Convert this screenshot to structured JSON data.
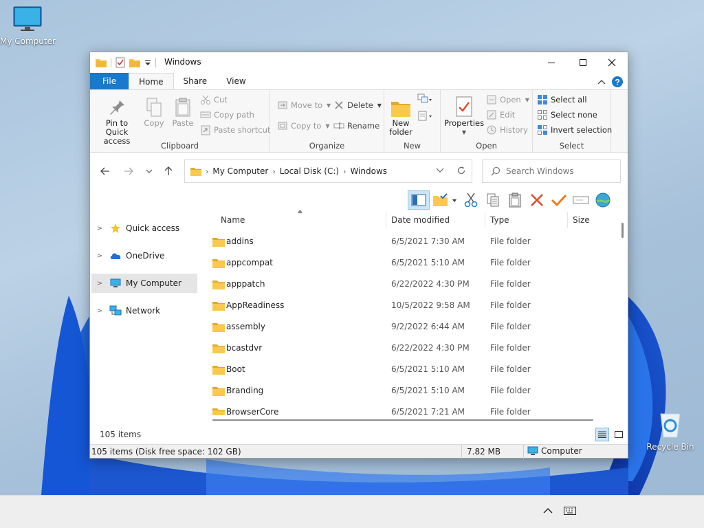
{
  "desktop": {
    "my_computer": "My Computer",
    "recycle_bin": "Recycle Bin"
  },
  "window": {
    "title": "Windows",
    "tabs": [
      "File",
      "Home",
      "Share",
      "View"
    ],
    "active_tab": "Home"
  },
  "ribbon": {
    "clipboard": {
      "group": "Clipboard",
      "pin_line1": "Pin to Quick",
      "pin_line2": "access",
      "copy": "Copy",
      "paste": "Paste",
      "cut": "Cut",
      "copy_path": "Copy path",
      "paste_shortcut": "Paste shortcut"
    },
    "organize": {
      "group": "Organize",
      "move_to": "Move to",
      "copy_to": "Copy to",
      "delete": "Delete",
      "rename": "Rename"
    },
    "new": {
      "group": "New",
      "new_folder_line1": "New",
      "new_folder_line2": "folder"
    },
    "open": {
      "group": "Open",
      "properties": "Properties",
      "open": "Open",
      "edit": "Edit",
      "history": "History"
    },
    "select": {
      "group": "Select",
      "select_all": "Select all",
      "select_none": "Select none",
      "invert_selection": "Invert selection"
    }
  },
  "address": {
    "crumbs": [
      "My Computer",
      "Local Disk (C:)",
      "Windows"
    ],
    "search_placeholder": "Search Windows"
  },
  "nav": {
    "items": [
      "Quick access",
      "OneDrive",
      "My Computer",
      "Network"
    ],
    "selected": "My Computer"
  },
  "columns": {
    "name": "Name",
    "date": "Date modified",
    "type": "Type",
    "size": "Size"
  },
  "files": [
    {
      "name": "addins",
      "date": "6/5/2021 7:30 AM",
      "type": "File folder"
    },
    {
      "name": "appcompat",
      "date": "6/5/2021 5:10 AM",
      "type": "File folder"
    },
    {
      "name": "apppatch",
      "date": "6/22/2022 4:30 PM",
      "type": "File folder"
    },
    {
      "name": "AppReadiness",
      "date": "10/5/2022 9:58 AM",
      "type": "File folder"
    },
    {
      "name": "assembly",
      "date": "9/2/2022 6:44 AM",
      "type": "File folder"
    },
    {
      "name": "bcastdvr",
      "date": "6/22/2022 4:30 PM",
      "type": "File folder"
    },
    {
      "name": "Boot",
      "date": "6/5/2021 5:10 AM",
      "type": "File folder"
    },
    {
      "name": "Branding",
      "date": "6/5/2021 5:10 AM",
      "type": "File folder"
    },
    {
      "name": "BrowserCore",
      "date": "6/5/2021 7:21 AM",
      "type": "File folder"
    }
  ],
  "status": {
    "item_count": "105 items",
    "disk_info": "105 items (Disk free space: 102 GB)",
    "size": "7.82 MB",
    "location": "Computer"
  },
  "colors": {
    "accent": "#1979ca",
    "folder": "#f8c94c",
    "folder_dark": "#e3a92a"
  }
}
